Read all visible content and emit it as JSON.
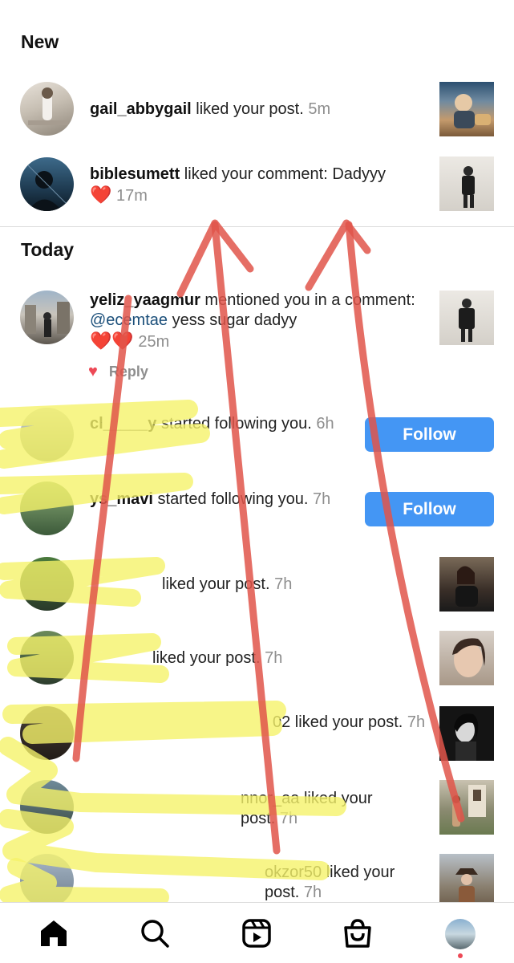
{
  "sections": {
    "new": "New",
    "today": "Today"
  },
  "new_items": [
    {
      "username": "gail_abbygail",
      "action": " liked your post.",
      "time": "5m"
    },
    {
      "username": "biblesumett",
      "action": " liked your comment: Dadyyy",
      "time": "17m"
    }
  ],
  "mention": {
    "username": "yeliz_yaagmur",
    "action": " mentioned you in a comment: ",
    "tag": "@ecemtae",
    "message": " yess sugar dadyy",
    "time": "25m",
    "reply_label": "Reply"
  },
  "follow_items": [
    {
      "username": "cl_____y",
      "action": " started following you.",
      "time": "6h",
      "button": "Follow"
    },
    {
      "username": "ys_mavi",
      "action": " started following you.",
      "time": "7h",
      "button": "Follow"
    }
  ],
  "like_items": [
    {
      "text": "liked your post.",
      "time": "7h"
    },
    {
      "text": "liked your post.",
      "time": "7h"
    },
    {
      "text": "02 liked your post.",
      "time": "7h"
    },
    {
      "text": "nnor_aa liked your post.",
      "time": "7h"
    },
    {
      "text": "okzor50 liked your post.",
      "time": "7h"
    }
  ],
  "nav": {
    "items": [
      "home-icon",
      "search-icon",
      "reels-icon",
      "shop-icon",
      "profile-avatar"
    ],
    "active_color": "#000000",
    "notification_dot_color": "#ed4956"
  },
  "colors": {
    "follow_button": "#4496f4",
    "heart": "#e0242c",
    "timestamp": "#8e8e8e",
    "mention_link": "#1b4f7a",
    "annotation_red": "#e0554a",
    "annotation_yellow": "#f5f36a"
  }
}
